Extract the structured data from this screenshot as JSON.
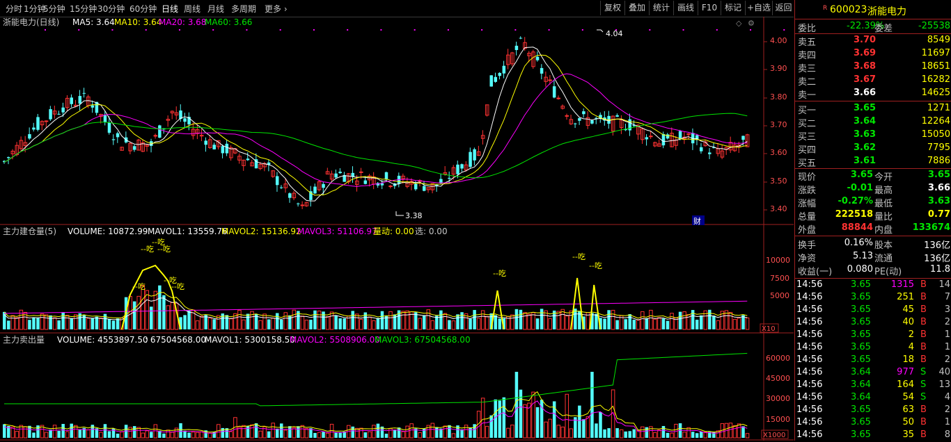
{
  "toolbar": {
    "periods": [
      "分时",
      "1分钟",
      "5分钟",
      "15分钟",
      "30分钟",
      "60分钟",
      "日线",
      "周线",
      "月线",
      "多周期",
      "更多"
    ],
    "active_period": "日线",
    "right_buttons": [
      "复权",
      "叠加",
      "统计",
      "画线",
      "F10",
      "标记",
      "+自选",
      "返回"
    ]
  },
  "main_chart": {
    "legend": {
      "stock": "浙能电力(日线)",
      "ma5": "MA5: 3.64",
      "ma10": "MA10: 3.64",
      "ma20": "MA20: 3.68",
      "ma60": "MA60: 3.66"
    },
    "ylabels": [
      "4.00",
      "3.90",
      "3.80",
      "3.70",
      "3.60",
      "3.50",
      "3.40"
    ],
    "high_label": "4.04",
    "low_label": "3.38",
    "cai_label": "财"
  },
  "ind1": {
    "legend": {
      "name": "主力建仓量(5)",
      "volume": "VOLUME: 10872.99",
      "mavol1": "MAVOL1: 13559.76",
      "mavol2": "MAVOL2: 15136.92",
      "mavol3": "MAVOL3: 51106.97",
      "liangdong": "量动: 0.00",
      "xuan": "选: 0.00"
    },
    "ylabels": [
      "10000",
      "7500",
      "5000"
    ],
    "unit": "X10",
    "chi_label": "--吃"
  },
  "ind2": {
    "legend": {
      "name": "主力卖出量",
      "volume": "VOLUME: 4553897.50",
      "val": ": 67504568.00",
      "mavol1": "MAVOL1: 5300158.50",
      "mavol2": "MAVOL2: 5508906.00",
      "mavol3": "MAVOL3: 67504568.00"
    },
    "ylabels": [
      "60000",
      "45000",
      "30000",
      "15000"
    ],
    "unit": "X1000"
  },
  "quote": {
    "code_prefix": "R",
    "code": "600023",
    "name": "浙能电力",
    "weibi": {
      "label": "委比",
      "value": "-22.39%",
      "label2": "委差",
      "value2": "-25538"
    },
    "asks": [
      {
        "label": "卖五",
        "price": "3.70",
        "vol": "8549"
      },
      {
        "label": "卖四",
        "price": "3.69",
        "vol": "11697"
      },
      {
        "label": "卖三",
        "price": "3.68",
        "vol": "18651"
      },
      {
        "label": "卖二",
        "price": "3.67",
        "vol": "16282"
      },
      {
        "label": "卖一",
        "price": "3.66",
        "vol": "14625"
      }
    ],
    "bids": [
      {
        "label": "买一",
        "price": "3.65",
        "vol": "1271"
      },
      {
        "label": "买二",
        "price": "3.64",
        "vol": "12264"
      },
      {
        "label": "买三",
        "price": "3.63",
        "vol": "15050"
      },
      {
        "label": "买四",
        "price": "3.62",
        "vol": "7795"
      },
      {
        "label": "买五",
        "price": "3.61",
        "vol": "7886"
      }
    ],
    "stats": [
      {
        "l1": "现价",
        "v1": "3.65",
        "l2": "今开",
        "v2": "3.65"
      },
      {
        "l1": "涨跌",
        "v1": "-0.01",
        "l2": "最高",
        "v2": "3.66"
      },
      {
        "l1": "涨幅",
        "v1": "-0.27%",
        "l2": "最低",
        "v2": "3.63"
      },
      {
        "l1": "总量",
        "v1": "222518",
        "l2": "量比",
        "v2": "0.77"
      },
      {
        "l1": "外盘",
        "v1": "88844",
        "l2": "内盘",
        "v2": "133674"
      }
    ],
    "info": [
      {
        "l1": "换手",
        "v1": "0.16%",
        "l2": "股本",
        "v2": "136亿"
      },
      {
        "l1": "净资",
        "v1": "5.13",
        "l2": "流通",
        "v2": "136亿"
      },
      {
        "l1": "收益(一)",
        "v1": "0.080",
        "l2": "PE(动)",
        "v2": "11.8"
      }
    ],
    "ticks": [
      {
        "time": "14:56",
        "price": "3.65",
        "vol": "1315",
        "side": "B",
        "n": "14"
      },
      {
        "time": "14:56",
        "price": "3.65",
        "vol": "251",
        "side": "B",
        "n": "7"
      },
      {
        "time": "14:56",
        "price": "3.65",
        "vol": "45",
        "side": "B",
        "n": "3"
      },
      {
        "time": "14:56",
        "price": "3.65",
        "vol": "40",
        "side": "B",
        "n": "2"
      },
      {
        "time": "14:56",
        "price": "3.65",
        "vol": "2",
        "side": "B",
        "n": "1"
      },
      {
        "time": "14:56",
        "price": "3.65",
        "vol": "4",
        "side": "B",
        "n": "1"
      },
      {
        "time": "14:56",
        "price": "3.65",
        "vol": "18",
        "side": "B",
        "n": "2"
      },
      {
        "time": "14:56",
        "price": "3.64",
        "vol": "977",
        "side": "S",
        "n": "40"
      },
      {
        "time": "14:56",
        "price": "3.64",
        "vol": "164",
        "side": "S",
        "n": "13"
      },
      {
        "time": "14:56",
        "price": "3.64",
        "vol": "54",
        "side": "S",
        "n": "4"
      },
      {
        "time": "14:56",
        "price": "3.65",
        "vol": "63",
        "side": "B",
        "n": "2"
      },
      {
        "time": "14:56",
        "price": "3.65",
        "vol": "50",
        "side": "B",
        "n": "1"
      },
      {
        "time": "14:56",
        "price": "3.65",
        "vol": "35",
        "side": "B",
        "n": "8"
      }
    ]
  },
  "colors": {
    "up": "#ff3232",
    "down": "#54fcfc",
    "ma5": "#ffffff",
    "ma10": "#ffff00",
    "ma20": "#ff00ff",
    "ma60": "#00e600",
    "border": "#a02020",
    "grid": "#a02020"
  }
}
